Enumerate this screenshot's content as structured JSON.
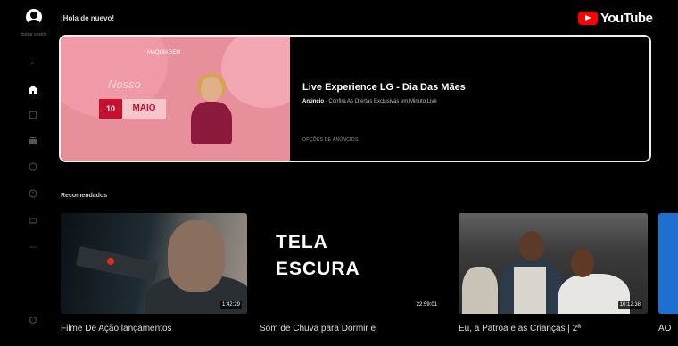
{
  "header": {
    "greeting": "¡Hola de nuevo!",
    "logo_text": "YouTube"
  },
  "sidebar": {
    "signin_text": "Iniciar sesión",
    "icons": [
      "home-icon",
      "shorts-icon",
      "subscriptions-icon",
      "library-icon",
      "history-icon",
      "gaming-icon",
      "more-icon",
      "settings-icon"
    ]
  },
  "ad": {
    "image_top_text": "MAQUIAGEM",
    "image_title": "Nosso",
    "image_day": "10",
    "image_month": "MAIO",
    "title": "Live Experience LG - Dia Das Mães",
    "sponsor_label": "Anúncio",
    "subtitle": "· Confira As Ofertas Exclusivas em Minuto Live",
    "options_label": "OPÇÕES DE ANÚNCIOS"
  },
  "section": {
    "title": "Recomendados"
  },
  "videos": [
    {
      "title": "Filme De Ação lançamentos",
      "duration": "1:42:29"
    },
    {
      "title": "Som de Chuva para Dormir e",
      "duration": "22:59:01",
      "thumb_text_line1": "TELA",
      "thumb_text_line2": "ESCURA"
    },
    {
      "title": "Eu, a Patroa e as Crianças | 2ª",
      "duration": "10:12:38"
    },
    {
      "title": "AO"
    }
  ],
  "colors": {
    "background": "#000000",
    "youtube_red": "#ff0000",
    "ad_border": "#eeeeee"
  }
}
